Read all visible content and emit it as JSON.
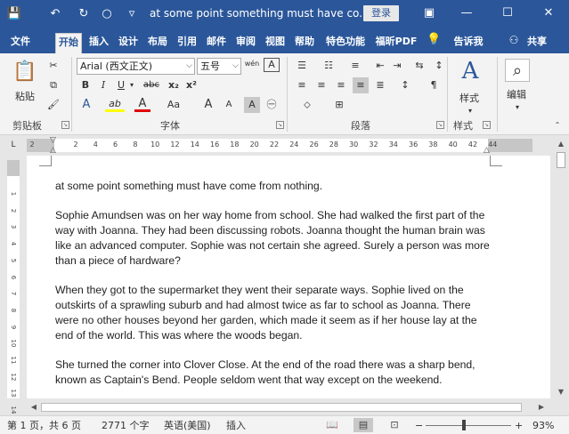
{
  "titlebar": {
    "document_title": "at some point something must have co...",
    "login_label": "登录",
    "save_icon": "💾",
    "undo_icon": "↶",
    "redo_icon": "↻",
    "circle_icon": "○",
    "customize_icon": "▿",
    "ribbon_display_icon": "▣",
    "minimize_icon": "—",
    "restore_icon": "☐",
    "close_icon": "✕"
  },
  "tabs": [
    {
      "label": "文件"
    },
    {
      "label": "开始"
    },
    {
      "label": "插入"
    },
    {
      "label": "设计"
    },
    {
      "label": "布局"
    },
    {
      "label": "引用"
    },
    {
      "label": "邮件"
    },
    {
      "label": "审阅"
    },
    {
      "label": "视图"
    },
    {
      "label": "帮助"
    },
    {
      "label": "特色功能"
    },
    {
      "label": "福昕PDF"
    }
  ],
  "tell_me": {
    "icon": "💡",
    "label": "告诉我"
  },
  "share": {
    "icon": "⚇",
    "label": "共享"
  },
  "ribbon": {
    "clipboard": {
      "paste_label": "粘贴",
      "paste_icon": "📋",
      "cut_icon": "✂",
      "copy_icon": "⧉",
      "format_painter_icon": "🖌",
      "group_label": "剪贴板"
    },
    "font": {
      "font_name": "Arial (西文正文)",
      "font_size": "五号",
      "phonetic_icon": "wén",
      "char_border_icon": "A",
      "bold": "B",
      "italic": "I",
      "underline": "U",
      "strike": "abc",
      "subscript": "x₂",
      "superscript": "x²",
      "text_effect": "A",
      "highlight": "ab",
      "font_color": "A",
      "change_case": "Aa",
      "grow": "A",
      "shrink": "A",
      "char_shading": "A",
      "enclose": "㊀",
      "group_label": "字体"
    },
    "paragraph": {
      "bullets_icon": "☰",
      "numbering_icon": "☷",
      "multilevel_icon": "≡",
      "decrease_indent_icon": "⇤",
      "increase_indent_icon": "⇥",
      "chinese_layout_icon": "⇆",
      "sort_icon": "↕",
      "show_marks_icon": "¶",
      "align_left_icon": "≡",
      "center_icon": "≡",
      "align_right_icon": "≡",
      "justify_icon": "≡",
      "distributed_icon": "≣",
      "line_spacing_icon": "↕",
      "shading_icon": "⬦",
      "borders_icon": "⊞",
      "group_label": "段落"
    },
    "styles": {
      "label": "样式",
      "icon": "A",
      "group_label": "样式"
    },
    "editing": {
      "label": "编辑",
      "icon": "⌕"
    }
  },
  "ruler": {
    "tab_selector_icon": "L",
    "ticks": [
      "2",
      "2",
      "4",
      "6",
      "8",
      "10",
      "12",
      "14",
      "16",
      "18",
      "20",
      "22",
      "24",
      "26",
      "28",
      "30",
      "32",
      "34",
      "36",
      "38",
      "40",
      "42",
      "44"
    ],
    "vticks": [
      "1",
      "2",
      "3",
      "4",
      "5",
      "6",
      "7",
      "8",
      "9",
      "10",
      "11",
      "12",
      "13",
      "14"
    ]
  },
  "document": {
    "paragraphs": [
      "at some point something must have come from nothing.",
      "Sophie Amundsen was on her way home from school. She had walked the first part of the way with Joanna. They had been discussing robots. Joanna thought the human brain was like an advanced computer. Sophie was not certain she agreed. Surely a person was more than a piece of hardware?",
      "When they got to the supermarket they went their separate ways. Sophie lived on the outskirts of a sprawling suburb and had almost twice as far to school as Joanna. There were no other houses beyond her garden, which made it seem as if her house lay at the end of the world. This was where the woods began.",
      "She turned the corner into Clover Close. At the end of the road there was a sharp bend, known as Captain's Bend. People seldom went that way except on the weekend."
    ]
  },
  "scroll": {
    "up_icon": "▲",
    "down_icon": "▼",
    "left_icon": "◀",
    "right_icon": "▶"
  },
  "status": {
    "page": "第 1 页，共 6 页",
    "words": "2771 个字",
    "language": "英语(美国)",
    "mode": "插入",
    "read_icon": "📖",
    "print_icon": "▤",
    "web_icon": "⊡",
    "zoom_out": "−",
    "zoom_in": "+",
    "zoom_level": "93%"
  }
}
